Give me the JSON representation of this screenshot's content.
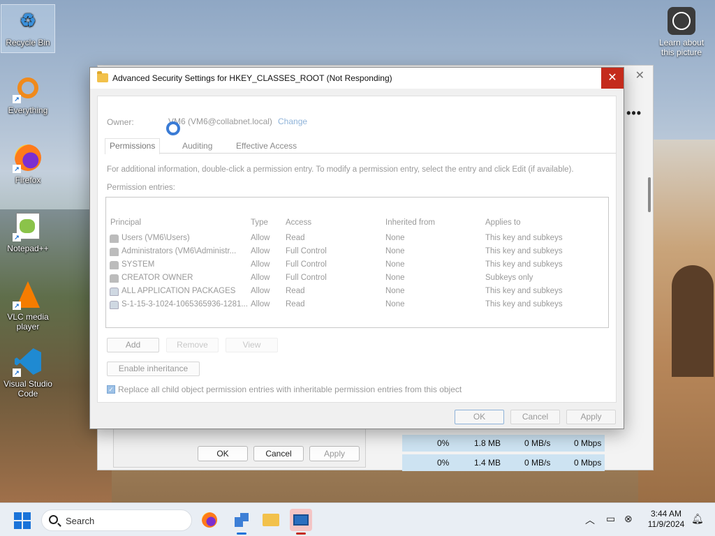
{
  "desktop": {
    "icons": [
      {
        "label": "Recycle Bin",
        "icon": "recycle-bin-icon"
      },
      {
        "label": "Everything",
        "icon": "everything-search-icon"
      },
      {
        "label": "Firefox",
        "icon": "firefox-icon"
      },
      {
        "label": "Notepad++",
        "icon": "notepadpp-icon"
      },
      {
        "label": "VLC media player",
        "icon": "vlc-icon"
      },
      {
        "label": "Visual Studio Code",
        "icon": "vscode-icon"
      }
    ],
    "learn": "Learn about this picture"
  },
  "dialog": {
    "title": "Advanced Security Settings for HKEY_CLASSES_ROOT (Not Responding)",
    "owner_label": "Owner:",
    "owner_value": "VM6 (VM6@collabnet.local)",
    "owner_change": "Change",
    "tabs": [
      "Permissions",
      "Auditing",
      "Effective Access"
    ],
    "info": "For additional information, double-click a permission entry. To modify a permission entry, select the entry and click Edit (if available).",
    "entries_label": "Permission entries:",
    "columns": [
      "Principal",
      "Type",
      "Access",
      "Inherited from",
      "Applies to"
    ],
    "rows": [
      {
        "principal": "Users (VM6\\Users)",
        "type": "Allow",
        "access": "Read",
        "inherited": "None",
        "applies": "This key and subkeys"
      },
      {
        "principal": "Administrators (VM6\\Administr...",
        "type": "Allow",
        "access": "Full Control",
        "inherited": "None",
        "applies": "This key and subkeys"
      },
      {
        "principal": "SYSTEM",
        "type": "Allow",
        "access": "Full Control",
        "inherited": "None",
        "applies": "This key and subkeys"
      },
      {
        "principal": "CREATOR OWNER",
        "type": "Allow",
        "access": "Full Control",
        "inherited": "None",
        "applies": "Subkeys only"
      },
      {
        "principal": "ALL APPLICATION PACKAGES",
        "type": "Allow",
        "access": "Read",
        "inherited": "None",
        "applies": "This key and subkeys"
      },
      {
        "principal": "S-1-15-3-1024-1065365936-1281...",
        "type": "Allow",
        "access": "Read",
        "inherited": "None",
        "applies": "This key and subkeys"
      }
    ],
    "add": "Add",
    "remove": "Remove",
    "view": "View",
    "enable_inheritance": "Enable inheritance",
    "replace_label": "Replace all child object permission entries with inheritable permission entries from this object",
    "ok": "OK",
    "cancel": "Cancel",
    "apply": "Apply"
  },
  "background_window": {
    "ok": "OK",
    "cancel": "Cancel",
    "apply": "Apply",
    "rows": [
      {
        "cpu": "0%",
        "mem": "1.8 MB",
        "disk": "0 MB/s",
        "net": "0 Mbps"
      },
      {
        "cpu": "0%",
        "mem": "1.4 MB",
        "disk": "0 MB/s",
        "net": "0 Mbps"
      }
    ]
  },
  "taskbar": {
    "search": "Search",
    "time": "3:44 AM",
    "date": "11/9/2024"
  }
}
